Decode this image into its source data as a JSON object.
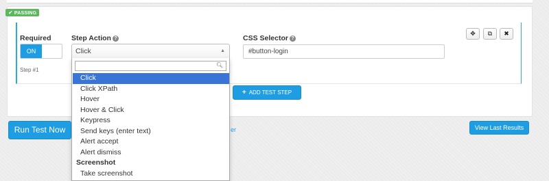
{
  "status_badge": {
    "text": "PASSING",
    "icon": "check-icon",
    "color": "#5cb85c"
  },
  "step": {
    "required_label": "Required",
    "toggle_on": "ON",
    "step_action_label": "Step Action",
    "selected_action": "Click",
    "css_selector_label": "CSS Selector",
    "css_selector_value": "#button-login",
    "step_number": "Step #1",
    "controls": [
      "move-icon",
      "copy-icon",
      "close-icon"
    ]
  },
  "dropdown": {
    "search_value": "",
    "items": [
      {
        "label": "Click",
        "selected": true
      },
      {
        "label": "Click XPath"
      },
      {
        "label": "Hover"
      },
      {
        "label": "Hover & Click"
      },
      {
        "label": "Keypress"
      },
      {
        "label": "Send keys (enter text)"
      },
      {
        "label": "Alert accept"
      },
      {
        "label": "Alert dismiss"
      }
    ],
    "group_label": "Screenshot",
    "group_items": [
      {
        "label": "Take screenshot"
      }
    ]
  },
  "buttons": {
    "add_test_step": "ADD TEST STEP",
    "run_test_now": "Run Test Now",
    "view_last_results": "View Last Results",
    "partial_link": "er"
  },
  "colors": {
    "accent": "#1e9de2",
    "selected_item": "#3875d7",
    "step_border": "#29abe2"
  }
}
